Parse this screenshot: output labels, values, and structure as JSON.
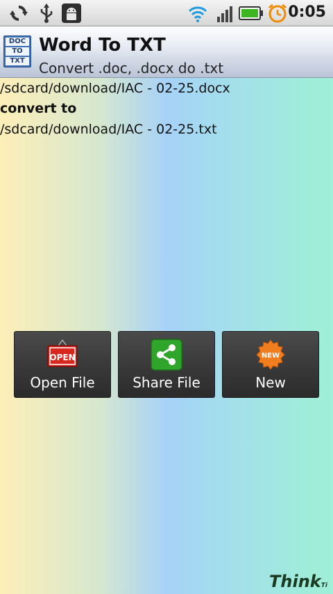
{
  "status_bar": {
    "icons": [
      "sync-icon",
      "usb-icon",
      "android-debug-icon",
      "wifi-icon",
      "signal-icon",
      "battery-icon",
      "alarm-icon"
    ],
    "time": "0:05",
    "accent": "#f08a00"
  },
  "app": {
    "icon_lines": [
      "DOC",
      "TO",
      "TXT"
    ],
    "title": "Word To TXT",
    "subtitle": "Convert .doc, .docx do .txt"
  },
  "conversion": {
    "source_path": "/sdcard/download/IAC - 02-25.docx",
    "separator": "convert to",
    "target_path": "/sdcard/download/IAC - 02-25.txt"
  },
  "actions": {
    "open_label": "Open File",
    "open_icon_text": "OPEN",
    "share_label": "Share File",
    "new_label": "New",
    "new_icon_text": "NEW"
  },
  "footer": {
    "logo_text": "Think",
    "logo_suffix": "Ti"
  }
}
